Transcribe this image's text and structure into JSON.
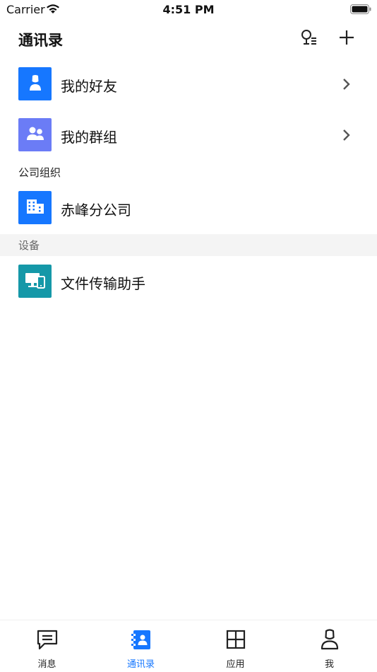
{
  "status_bar": {
    "carrier": "Carrier",
    "time": "4:51 PM"
  },
  "header": {
    "title": "通讯录",
    "search_icon": "contacts-search-icon",
    "add_icon": "plus-icon"
  },
  "rows": [
    {
      "label": "我的好友",
      "icon": "person-icon",
      "color": "#1677ff",
      "chevron": true
    },
    {
      "label": "我的群组",
      "icon": "group-icon",
      "color": "#6b7cf6",
      "chevron": true
    }
  ],
  "sections": [
    {
      "header": "公司组织",
      "items": [
        {
          "label": "赤峰分公司",
          "icon": "building-icon",
          "color": "#1677ff"
        }
      ]
    },
    {
      "header": "设备",
      "items": [
        {
          "label": "文件传输助手",
          "icon": "devices-icon",
          "color": "#1598a8"
        }
      ]
    }
  ],
  "tabs": [
    {
      "label": "消息",
      "icon": "message-icon",
      "active": false
    },
    {
      "label": "通讯录",
      "icon": "contacts-icon",
      "active": true
    },
    {
      "label": "应用",
      "icon": "apps-grid-icon",
      "active": false
    },
    {
      "label": "我",
      "icon": "profile-icon",
      "active": false
    }
  ],
  "colors": {
    "accent": "#1677ff",
    "section_bg": "#f4f4f4",
    "muted_text": "#666666"
  }
}
